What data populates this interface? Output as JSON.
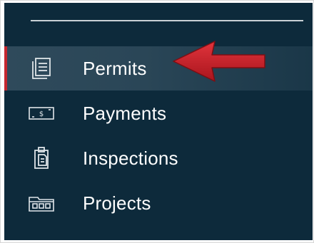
{
  "nav": {
    "items": [
      {
        "label": "Permits",
        "icon": "document-icon",
        "active": true
      },
      {
        "label": "Payments",
        "icon": "dollar-bill-icon",
        "active": false
      },
      {
        "label": "Inspections",
        "icon": "clipboard-icon",
        "active": false
      },
      {
        "label": "Projects",
        "icon": "folder-icon",
        "active": false
      }
    ]
  },
  "colors": {
    "sidebar_bg": "#0d2a3b",
    "active_bg": "#2a4657",
    "active_accent": "#c4272f",
    "arrow": "#c8202a",
    "text": "#ffffff"
  }
}
